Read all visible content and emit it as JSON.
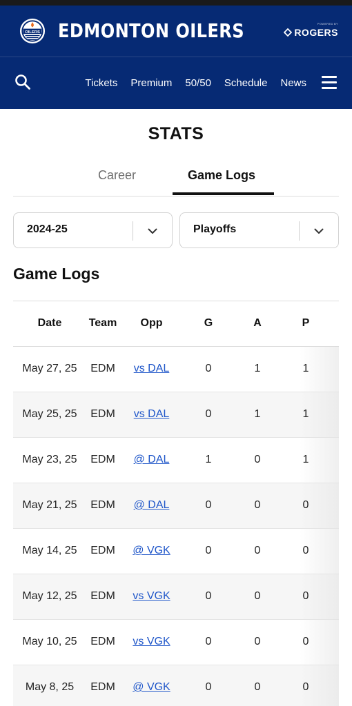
{
  "header": {
    "team_name": "EDMONTON OILERS",
    "logo_text": "OILERS",
    "sponsor_small": "POWERED BY",
    "sponsor_name": "ROGERS",
    "brand_color": "#062a74",
    "accent_color": "#e96b1f"
  },
  "nav": {
    "search_icon": "search-icon",
    "links": [
      "Tickets",
      "Premium",
      "50/50",
      "Schedule",
      "News"
    ],
    "menu_icon": "hamburger-menu-icon"
  },
  "page": {
    "title": "STATS",
    "tabs": [
      {
        "label": "Career",
        "active": false
      },
      {
        "label": "Game Logs",
        "active": true
      }
    ],
    "filters": {
      "season": "2024-25",
      "game_type": "Playoffs"
    },
    "section_title": "Game Logs"
  },
  "table": {
    "columns": [
      "Date",
      "Team",
      "Opp",
      "G",
      "A",
      "P"
    ],
    "rows": [
      {
        "date": "May 27, 25",
        "team": "EDM",
        "opp": "vs DAL",
        "g": "0",
        "a": "1",
        "p": "1"
      },
      {
        "date": "May 25, 25",
        "team": "EDM",
        "opp": "vs DAL",
        "g": "0",
        "a": "1",
        "p": "1"
      },
      {
        "date": "May 23, 25",
        "team": "EDM",
        "opp": "@ DAL",
        "g": "1",
        "a": "0",
        "p": "1"
      },
      {
        "date": "May 21, 25",
        "team": "EDM",
        "opp": "@ DAL",
        "g": "0",
        "a": "0",
        "p": "0"
      },
      {
        "date": "May 14, 25",
        "team": "EDM",
        "opp": "@ VGK",
        "g": "0",
        "a": "0",
        "p": "0"
      },
      {
        "date": "May 12, 25",
        "team": "EDM",
        "opp": "vs VGK",
        "g": "0",
        "a": "0",
        "p": "0"
      },
      {
        "date": "May 10, 25",
        "team": "EDM",
        "opp": "vs VGK",
        "g": "0",
        "a": "0",
        "p": "0"
      },
      {
        "date": "May 8, 25",
        "team": "EDM",
        "opp": "@ VGK",
        "g": "0",
        "a": "0",
        "p": "0"
      }
    ],
    "link_color": "#1f56c9"
  }
}
